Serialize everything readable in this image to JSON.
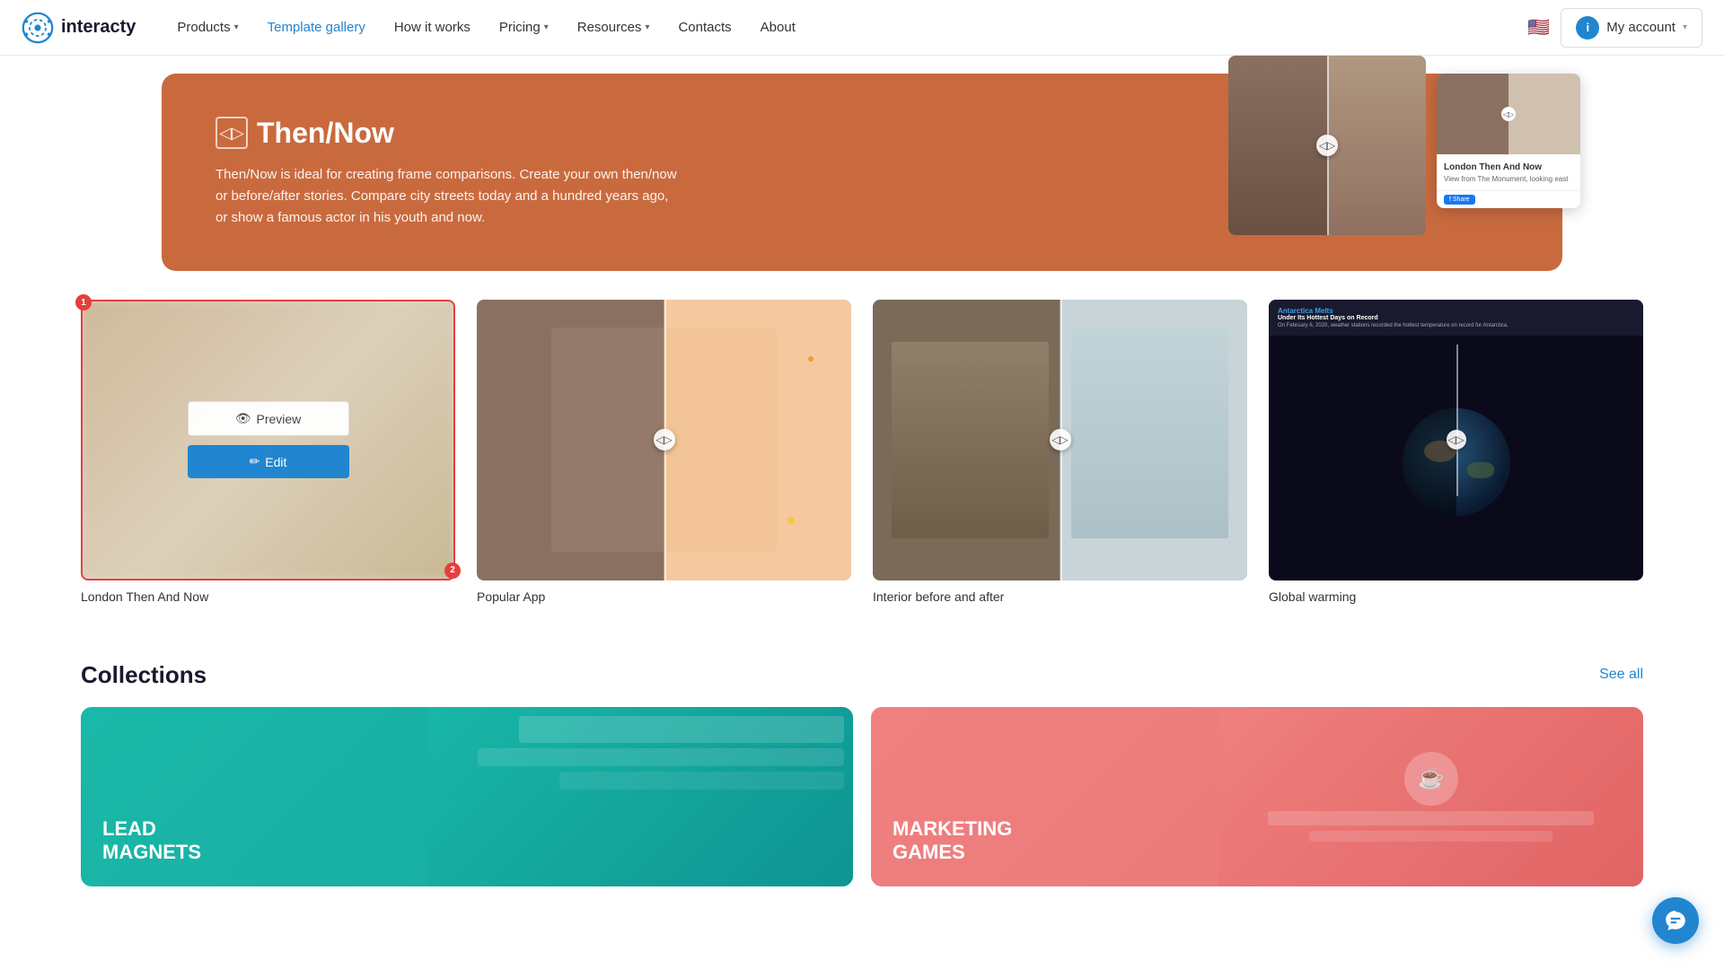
{
  "nav": {
    "logo_text": "interacty",
    "links": [
      {
        "label": "Products",
        "has_dropdown": true,
        "active": false
      },
      {
        "label": "Template gallery",
        "has_dropdown": false,
        "active": true
      },
      {
        "label": "How it works",
        "has_dropdown": false,
        "active": false
      },
      {
        "label": "Pricing",
        "has_dropdown": true,
        "active": false
      },
      {
        "label": "Resources",
        "has_dropdown": true,
        "active": false
      },
      {
        "label": "Contacts",
        "has_dropdown": false,
        "active": false
      },
      {
        "label": "About",
        "has_dropdown": false,
        "active": false
      }
    ],
    "flag": "🇺🇸",
    "account_label": "My account",
    "account_icon_label": "i"
  },
  "hero": {
    "icon": "◁▷",
    "title": "Then/Now",
    "description": "Then/Now is ideal for creating frame comparisons. Create your own then/now or before/after stories. Compare city streets today and a hundred years ago, or show a famous actor in his youth and now.",
    "article": {
      "title": "London Then And Now",
      "subtitle": "View from The Monument, looking east"
    }
  },
  "templates": [
    {
      "id": "london",
      "label": "London Then And Now",
      "has_overlay": true,
      "badge_1": "1",
      "badge_2": "2",
      "btn_preview": "Preview",
      "btn_edit": "Edit",
      "thumb_type": "blur"
    },
    {
      "id": "popular-app",
      "label": "Popular App",
      "has_overlay": false,
      "thumb_type": "face"
    },
    {
      "id": "interior",
      "label": "Interior before and after",
      "has_overlay": false,
      "thumb_type": "room"
    },
    {
      "id": "global-warming",
      "label": "Global warming",
      "has_overlay": false,
      "thumb_type": "earth",
      "earth_headline": "Antarctica Melts",
      "earth_subheadline": "Under Its Hottest Days on Record",
      "earth_date": "On February 6, 2020, weather stations recorded the hottest temperature on record for Antarctica."
    }
  ],
  "collections": {
    "title": "Collections",
    "see_all": "See all",
    "items": [
      {
        "id": "lead-magnets",
        "label": "LEAD\nMAGNETS",
        "color": "teal"
      },
      {
        "id": "marketing-games",
        "label": "MARKETING\nGAMES",
        "color": "pink"
      }
    ]
  },
  "chat_fab_title": "Open chat"
}
